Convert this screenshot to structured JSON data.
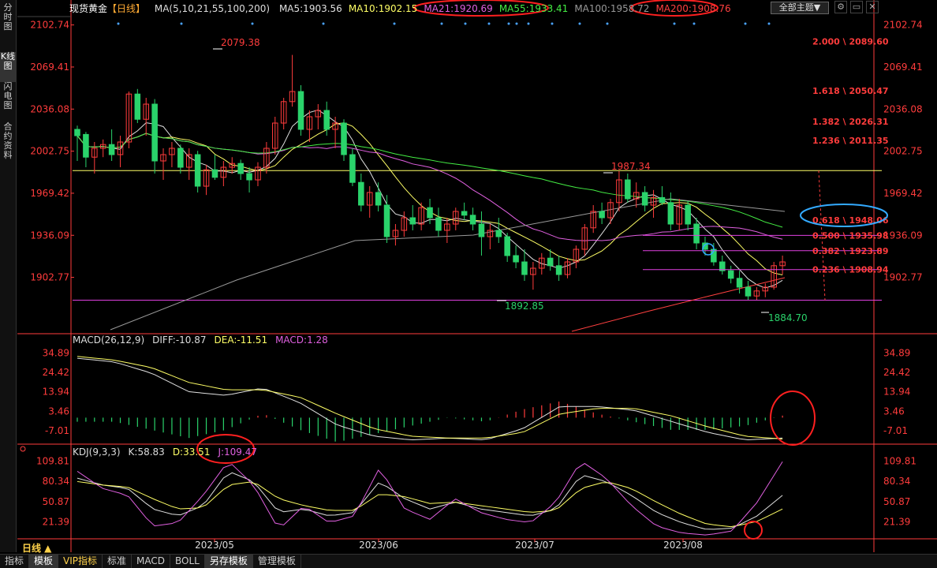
{
  "header": {
    "symbol": "现货黄金",
    "period_tag": "【日线】",
    "ma_label": "MA(5,10,21,55,100,200)",
    "ma_values": [
      {
        "label": "MA5:1903.56",
        "color": "#e0e0e0"
      },
      {
        "label": "MA10:1902.15",
        "color": "#ffff66"
      },
      {
        "label": "MA21:1920.69",
        "color": "#e060e0"
      },
      {
        "label": "MA55:1933.41",
        "color": "#44ee44"
      },
      {
        "label": "MA100:1958.72",
        "color": "#999999"
      },
      {
        "label": "MA200:1908.76",
        "color": "#ff4040"
      }
    ],
    "theme_button": "全部主题▼"
  },
  "left_tabs": [
    "分时图",
    "K线图",
    "闪电图",
    "合约资料"
  ],
  "bottom_tabs": [
    "指标",
    "模板",
    "VIP指标",
    "标准",
    "MACD",
    "BOLL",
    "另存模板",
    "管理模板"
  ],
  "period_button": "日线 ▲",
  "colors": {
    "up": "#ff3c3c",
    "down": "#2ad36b",
    "axis": "#ff3c3c"
  },
  "chart_data": {
    "type": "candlestick",
    "x_labels": [
      "2023/05",
      "2023/06",
      "2023/07",
      "2023/08"
    ],
    "price_axis": {
      "ticks": [
        "2102.74",
        "2069.41",
        "2036.08",
        "2002.75",
        "1969.42",
        "1936.09",
        "1902.77"
      ],
      "ylim": [
        1860,
        2110
      ]
    },
    "annotations": {
      "high": "2079.38",
      "mid_high": "1987.34",
      "low1": "1892.85",
      "low2": "1884.70"
    },
    "fibonacci": [
      {
        "label": "2.000 \\ 2089.60",
        "value": 2089.6
      },
      {
        "label": "1.618 \\ 2050.47",
        "value": 2050.47
      },
      {
        "label": "1.382 \\ 2026.31",
        "value": 2026.31
      },
      {
        "label": "1.236 \\ 2011.35",
        "value": 2011.35
      },
      {
        "label": "0.618 \\ 1948.06",
        "value": 1948.06
      },
      {
        "label": "0.500 \\ 1935.98",
        "value": 1935.98
      },
      {
        "label": "0.382 \\ 1923.89",
        "value": 1923.89
      },
      {
        "label": "0.236 \\ 1908.94",
        "value": 1908.94
      }
    ],
    "h_lines": [
      1987.34,
      1884.7
    ],
    "candles": [
      [
        2020,
        2023,
        1995,
        2015
      ],
      [
        2016,
        2018,
        1990,
        1998
      ],
      [
        1998,
        2010,
        1985,
        2005
      ],
      [
        2005,
        2012,
        1998,
        2008
      ],
      [
        2008,
        2020,
        1995,
        2000
      ],
      [
        2000,
        2015,
        1990,
        2010
      ],
      [
        2010,
        2050,
        2005,
        2048
      ],
      [
        2048,
        2052,
        2025,
        2028
      ],
      [
        2028,
        2045,
        2015,
        2040
      ],
      [
        2040,
        2044,
        1985,
        1995
      ],
      [
        1995,
        2005,
        1980,
        2000
      ],
      [
        2000,
        2010,
        1990,
        2005
      ],
      [
        2005,
        2008,
        1985,
        1990
      ],
      [
        1990,
        2005,
        1980,
        2000
      ],
      [
        2000,
        2003,
        1970,
        1975
      ],
      [
        1975,
        1992,
        1968,
        1988
      ],
      [
        1988,
        2000,
        1980,
        1982
      ],
      [
        1982,
        1995,
        1975,
        1990
      ],
      [
        1990,
        1998,
        1985,
        1993
      ],
      [
        1993,
        1996,
        1980,
        1985
      ],
      [
        1985,
        1990,
        1970,
        1980
      ],
      [
        1980,
        1994,
        1975,
        1990
      ],
      [
        1990,
        2010,
        1985,
        2005
      ],
      [
        2005,
        2030,
        2000,
        2025
      ],
      [
        2025,
        2045,
        2020,
        2042
      ],
      [
        2042,
        2079,
        2038,
        2050
      ],
      [
        2050,
        2055,
        2015,
        2020
      ],
      [
        2020,
        2035,
        2010,
        2030
      ],
      [
        2030,
        2040,
        2020,
        2035
      ],
      [
        2035,
        2042,
        2015,
        2020
      ],
      [
        2020,
        2030,
        2005,
        2025
      ],
      [
        2025,
        2028,
        1995,
        2000
      ],
      [
        2000,
        2005,
        1975,
        1978
      ],
      [
        1978,
        1985,
        1955,
        1960
      ],
      [
        1960,
        1975,
        1950,
        1970
      ],
      [
        1970,
        1978,
        1955,
        1960
      ],
      [
        1960,
        1968,
        1930,
        1935
      ],
      [
        1935,
        1945,
        1928,
        1940
      ],
      [
        1940,
        1955,
        1935,
        1950
      ],
      [
        1950,
        1960,
        1940,
        1945
      ],
      [
        1945,
        1962,
        1940,
        1958
      ],
      [
        1958,
        1965,
        1945,
        1950
      ],
      [
        1950,
        1958,
        1935,
        1940
      ],
      [
        1940,
        1950,
        1930,
        1945
      ],
      [
        1945,
        1958,
        1940,
        1955
      ],
      [
        1955,
        1962,
        1948,
        1952
      ],
      [
        1952,
        1958,
        1940,
        1945
      ],
      [
        1945,
        1955,
        1920,
        1935
      ],
      [
        1935,
        1945,
        1925,
        1940
      ],
      [
        1940,
        1950,
        1930,
        1935
      ],
      [
        1935,
        1938,
        1915,
        1920
      ],
      [
        1920,
        1928,
        1910,
        1915
      ],
      [
        1915,
        1925,
        1900,
        1905
      ],
      [
        1905,
        1915,
        1893,
        1910
      ],
      [
        1910,
        1922,
        1905,
        1918
      ],
      [
        1918,
        1925,
        1908,
        1912
      ],
      [
        1912,
        1920,
        1900,
        1905
      ],
      [
        1905,
        1918,
        1902,
        1915
      ],
      [
        1915,
        1928,
        1910,
        1925
      ],
      [
        1925,
        1945,
        1920,
        1942
      ],
      [
        1942,
        1960,
        1938,
        1955
      ],
      [
        1955,
        1962,
        1945,
        1950
      ],
      [
        1950,
        1965,
        1945,
        1962
      ],
      [
        1962,
        1987,
        1955,
        1980
      ],
      [
        1980,
        1985,
        1962,
        1965
      ],
      [
        1965,
        1978,
        1958,
        1970
      ],
      [
        1970,
        1975,
        1955,
        1960
      ],
      [
        1960,
        1972,
        1950,
        1966
      ],
      [
        1966,
        1975,
        1960,
        1962
      ],
      [
        1962,
        1970,
        1940,
        1945
      ],
      [
        1945,
        1965,
        1940,
        1960
      ],
      [
        1960,
        1963,
        1940,
        1945
      ],
      [
        1945,
        1950,
        1925,
        1930
      ],
      [
        1930,
        1935,
        1920,
        1925
      ],
      [
        1925,
        1930,
        1912,
        1915
      ],
      [
        1915,
        1920,
        1905,
        1908
      ],
      [
        1908,
        1912,
        1898,
        1902
      ],
      [
        1902,
        1908,
        1890,
        1895
      ],
      [
        1895,
        1900,
        1885,
        1888
      ],
      [
        1888,
        1895,
        1885,
        1892
      ],
      [
        1892,
        1898,
        1887,
        1895
      ],
      [
        1895,
        1915,
        1893,
        1912
      ],
      [
        1912,
        1920,
        1905,
        1915
      ]
    ],
    "macd": {
      "label": "MACD(26,12,9)",
      "diff": "DIFF:-10.87",
      "dea": "DEA:-11.51",
      "macd": "MACD:1.28",
      "ticks": [
        "34.89",
        "24.42",
        "13.94",
        "3.46",
        "-7.01"
      ],
      "ylim": [
        -13,
        38
      ]
    },
    "kdj": {
      "label": "KDJ(9,3,3)",
      "k": "K:58.83",
      "d": "D:33.51",
      "j": "J:109.47",
      "ticks": [
        "109.81",
        "80.34",
        "50.87",
        "21.39"
      ],
      "ylim": [
        0,
        115
      ]
    }
  }
}
